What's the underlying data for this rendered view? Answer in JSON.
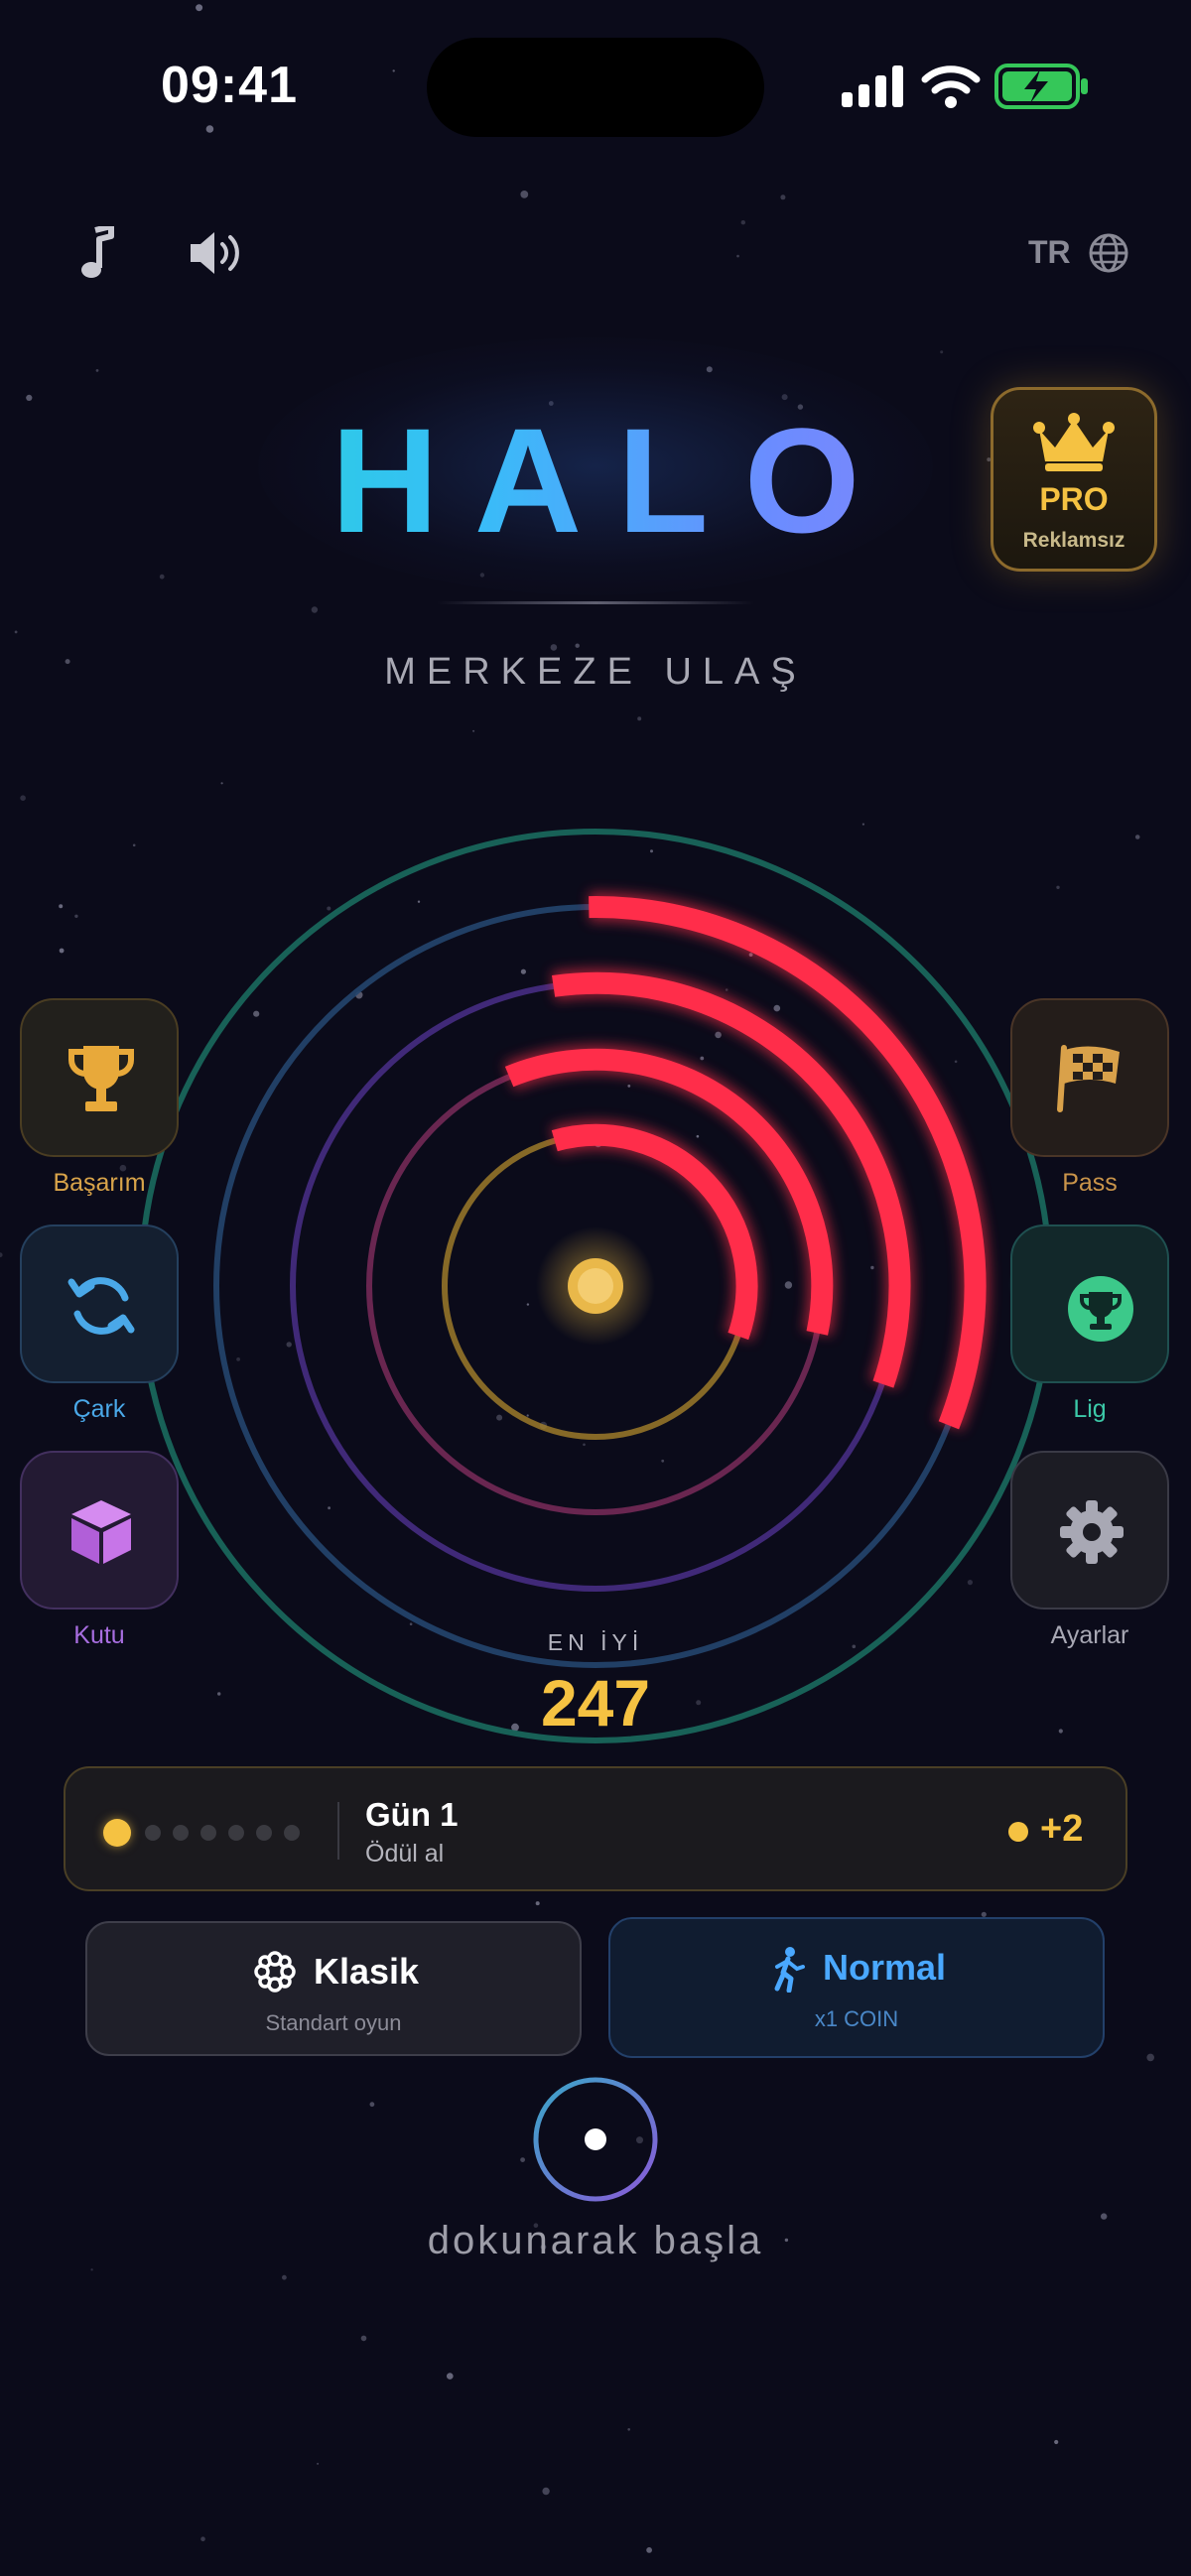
{
  "status_bar": {
    "time": "09:41"
  },
  "top_bar": {
    "language": "TR"
  },
  "title": {
    "text": "HALO",
    "subtitle": "MERKEZE ULAŞ"
  },
  "pro_badge": {
    "label": "PRO",
    "sublabel": "Reklamsız"
  },
  "left_menu": [
    {
      "label": "Başarım",
      "icon": "trophy-icon",
      "color": "#d9a44a"
    },
    {
      "label": "Çark",
      "icon": "refresh-icon",
      "color": "#4aa8e8"
    },
    {
      "label": "Kutu",
      "icon": "box-icon",
      "color": "#a86ee0"
    }
  ],
  "right_menu": [
    {
      "label": "Pass",
      "icon": "checkered-flag-icon",
      "color": "#c9944a"
    },
    {
      "label": "Lig",
      "icon": "league-trophy-icon",
      "color": "#3cc9a8"
    },
    {
      "label": "Ayarlar",
      "icon": "gear-icon",
      "color": "#a8a8b4"
    }
  ],
  "game": {
    "rings": [
      {
        "name": "ring-1",
        "color": "#b08a2c"
      },
      {
        "name": "ring-2",
        "color": "#7a2c5a"
      },
      {
        "name": "ring-3",
        "color": "#4a2f8a"
      },
      {
        "name": "ring-4",
        "color": "#24456e"
      },
      {
        "name": "ring-5",
        "color": "#1a6a5e"
      }
    ],
    "hazard_color": "#ff2d4a",
    "core_color": "#f5c242",
    "player_color": "#2de6c8"
  },
  "best_score": {
    "label": "EN İYİ",
    "value": "247"
  },
  "daily_reward": {
    "day_label": "Gün 1",
    "action_label": "Ödül al",
    "days_total": 7,
    "days_claimed": 1,
    "reward_value": "+2"
  },
  "modes": {
    "classic": {
      "title": "Klasik",
      "subtitle": "Standart oyun"
    },
    "difficulty": {
      "title": "Normal",
      "subtitle": "x1 COIN"
    }
  },
  "start": {
    "label": "dokunarak başla"
  }
}
